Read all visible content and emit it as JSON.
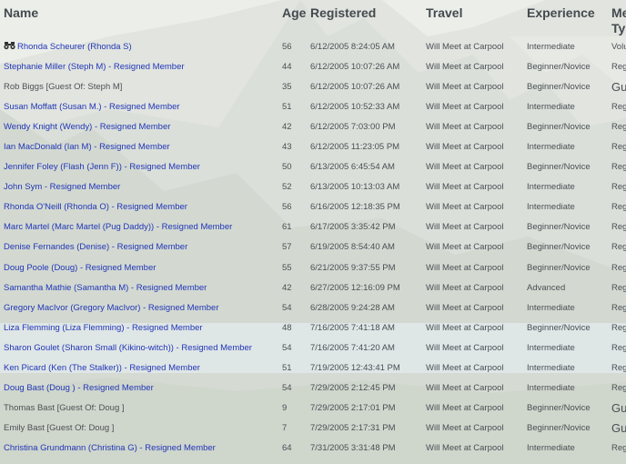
{
  "columns": {
    "name": "Name",
    "age": "Age",
    "registered": "Registered",
    "travel": "Travel",
    "experience": "Experience",
    "member_type": "Member Type"
  },
  "leader_icon": "binoculars-icon",
  "rows": [
    {
      "name": "Rhonda Scheurer (Rhonda S)",
      "age": "56",
      "registered": "6/12/2005 8:24:05 AM",
      "travel": "Will Meet at Carpool",
      "experience": "Intermediate",
      "member_type": "Volunteer",
      "link": true,
      "leader": true
    },
    {
      "name": "Stephanie Miller (Steph M) - Resigned Member",
      "age": "44",
      "registered": "6/12/2005 10:07:26 AM",
      "travel": "Will Meet at Carpool",
      "experience": "Beginner/Novice",
      "member_type": "Regular",
      "link": true
    },
    {
      "name": "Rob Biggs [Guest Of: Steph M]",
      "age": "35",
      "registered": "6/12/2005 10:07:26 AM",
      "travel": "Will Meet at Carpool",
      "experience": "Beginner/Novice",
      "member_type": "Guest",
      "link": false
    },
    {
      "name": "Susan Moffatt (Susan M.) - Resigned Member",
      "age": "51",
      "registered": "6/12/2005 10:52:33 AM",
      "travel": "Will Meet at Carpool",
      "experience": "Intermediate",
      "member_type": "Regular",
      "link": true
    },
    {
      "name": "Wendy Knight (Wendy) - Resigned Member",
      "age": "42",
      "registered": "6/12/2005 7:03:00 PM",
      "travel": "Will Meet at Carpool",
      "experience": "Beginner/Novice",
      "member_type": "Regular",
      "link": true
    },
    {
      "name": "Ian MacDonald (Ian M) - Resigned Member",
      "age": "43",
      "registered": "6/12/2005 11:23:05 PM",
      "travel": "Will Meet at Carpool",
      "experience": "Intermediate",
      "member_type": "Regular",
      "link": true
    },
    {
      "name": "Jennifer Foley (Flash (Jenn F)) - Resigned Member",
      "age": "50",
      "registered": "6/13/2005 6:45:54 AM",
      "travel": "Will Meet at Carpool",
      "experience": "Beginner/Novice",
      "member_type": "Regular",
      "link": true
    },
    {
      "name": "John Sym - Resigned Member",
      "age": "52",
      "registered": "6/13/2005 10:13:03 AM",
      "travel": "Will Meet at Carpool",
      "experience": "Intermediate",
      "member_type": "Regular",
      "link": true
    },
    {
      "name": "Rhonda O'Neill (Rhonda O) - Resigned Member",
      "age": "56",
      "registered": "6/16/2005 12:18:35 PM",
      "travel": "Will Meet at Carpool",
      "experience": "Intermediate",
      "member_type": "Regular",
      "link": true
    },
    {
      "name": "Marc Martel (Marc Martel (Pug Daddy)) - Resigned Member",
      "age": "61",
      "registered": "6/17/2005 3:35:42 PM",
      "travel": "Will Meet at Carpool",
      "experience": "Beginner/Novice",
      "member_type": "Regular",
      "link": true
    },
    {
      "name": "Denise Fernandes (Denise) - Resigned Member",
      "age": "57",
      "registered": "6/19/2005 8:54:40 AM",
      "travel": "Will Meet at Carpool",
      "experience": "Beginner/Novice",
      "member_type": "Regular",
      "link": true
    },
    {
      "name": "Doug Poole (Doug) - Resigned Member",
      "age": "55",
      "registered": "6/21/2005 9:37:55 PM",
      "travel": "Will Meet at Carpool",
      "experience": "Beginner/Novice",
      "member_type": "Regular",
      "link": true
    },
    {
      "name": "Samantha Mathie (Samantha M) - Resigned Member",
      "age": "42",
      "registered": "6/27/2005 12:16:09 PM",
      "travel": "Will Meet at Carpool",
      "experience": "Advanced",
      "member_type": "Regular",
      "link": true
    },
    {
      "name": "Gregory MacIvor (Gregory MacIvor) - Resigned Member",
      "age": "54",
      "registered": "6/28/2005 9:24:28 AM",
      "travel": "Will Meet at Carpool",
      "experience": "Intermediate",
      "member_type": "Regular",
      "link": true
    },
    {
      "name": "Liza Flemming (Liza Flemming) - Resigned Member",
      "age": "48",
      "registered": "7/16/2005 7:41:18 AM",
      "travel": "Will Meet at Carpool",
      "experience": "Beginner/Novice",
      "member_type": "Regular",
      "link": true
    },
    {
      "name": "Sharon Goulet (Sharon Small (Kikino-witch)) - Resigned Member",
      "age": "54",
      "registered": "7/16/2005 7:41:20 AM",
      "travel": "Will Meet at Carpool",
      "experience": "Intermediate",
      "member_type": "Regular",
      "link": true
    },
    {
      "name": "Ken Picard (Ken (The Stalker)) - Resigned Member",
      "age": "51",
      "registered": "7/19/2005 12:43:41 PM",
      "travel": "Will Meet at Carpool",
      "experience": "Intermediate",
      "member_type": "Regular",
      "link": true
    },
    {
      "name": "Doug Bast (Doug ) - Resigned Member",
      "age": "54",
      "registered": "7/29/2005 2:12:45 PM",
      "travel": "Will Meet at Carpool",
      "experience": "Intermediate",
      "member_type": "Regular",
      "link": true
    },
    {
      "name": "Thomas Bast [Guest Of: Doug ]",
      "age": "9",
      "registered": "7/29/2005 2:17:01 PM",
      "travel": "Will Meet at Carpool",
      "experience": "Beginner/Novice",
      "member_type": "Guest",
      "link": false
    },
    {
      "name": "Emily Bast [Guest Of: Doug ]",
      "age": "7",
      "registered": "7/29/2005 2:17:31 PM",
      "travel": "Will Meet at Carpool",
      "experience": "Beginner/Novice",
      "member_type": "Guest",
      "link": false
    },
    {
      "name": "Christina Grundmann (Christina G) - Resigned Member",
      "age": "64",
      "registered": "7/31/2005 3:31:48 PM",
      "travel": "Will Meet at Carpool",
      "experience": "Intermediate",
      "member_type": "Regular",
      "link": true
    }
  ]
}
